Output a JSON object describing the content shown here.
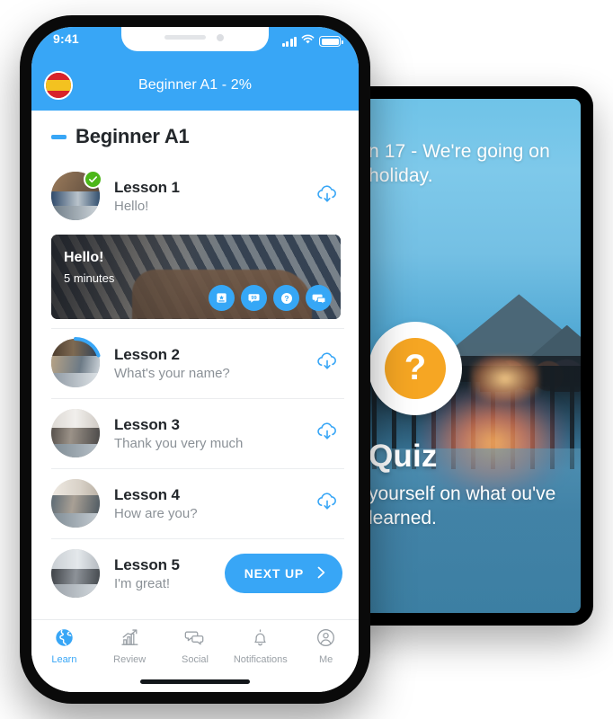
{
  "tablet": {
    "headline": "n 17 - We're going  on holiday.",
    "quiz_icon": "question-mark-icon",
    "quiz_title": "Quiz",
    "quiz_subtitle": " yourself on what  ou've learned."
  },
  "phone": {
    "status": {
      "time": "9:41",
      "signal_icon": "signal-bars-icon",
      "wifi_icon": "wifi-icon",
      "battery_icon": "battery-icon"
    },
    "header": {
      "flag_icon": "spain-flag-icon",
      "title": "Beginner A1 - 2%"
    },
    "section": {
      "collapse_icon": "collapse-minus-icon",
      "title": "Beginner A1"
    },
    "lessons": [
      {
        "name": "Lesson 1",
        "subtitle": "Hello!",
        "status": "completed",
        "badge_icon": "check-circle-icon",
        "action_icon": "cloud-download-icon"
      },
      {
        "name": "Lesson 2",
        "subtitle": "What's your name?",
        "status": "in-progress",
        "action_icon": "cloud-download-icon"
      },
      {
        "name": "Lesson 3",
        "subtitle": "Thank you very much",
        "status": "locked",
        "action_icon": "cloud-download-icon"
      },
      {
        "name": "Lesson 4",
        "subtitle": "How are you?",
        "status": "locked",
        "action_icon": "cloud-download-icon"
      },
      {
        "name": "Lesson 5",
        "subtitle": "I'm great!",
        "status": "next",
        "action_label": "NEXT UP",
        "action_icon": "chevron-right-icon"
      }
    ],
    "lesson_card": {
      "title": "Hello!",
      "duration": "5 minutes",
      "actions": [
        "flashcard-icon",
        "vocabulary-icon",
        "quiz-icon",
        "conversation-icon"
      ]
    },
    "tabs": [
      {
        "label": "Learn",
        "icon": "globe-icon",
        "active": true
      },
      {
        "label": "Review",
        "icon": "chart-icon",
        "active": false
      },
      {
        "label": "Social",
        "icon": "chat-icon",
        "active": false
      },
      {
        "label": "Notifications",
        "icon": "bell-icon",
        "active": false
      },
      {
        "label": "Me",
        "icon": "person-icon",
        "active": false
      }
    ]
  },
  "colors": {
    "accent_blue": "#38a6f6",
    "success_green": "#4cb719",
    "quiz_orange": "#f6a623",
    "text_dark": "#22262a",
    "text_muted": "#8b9197"
  }
}
